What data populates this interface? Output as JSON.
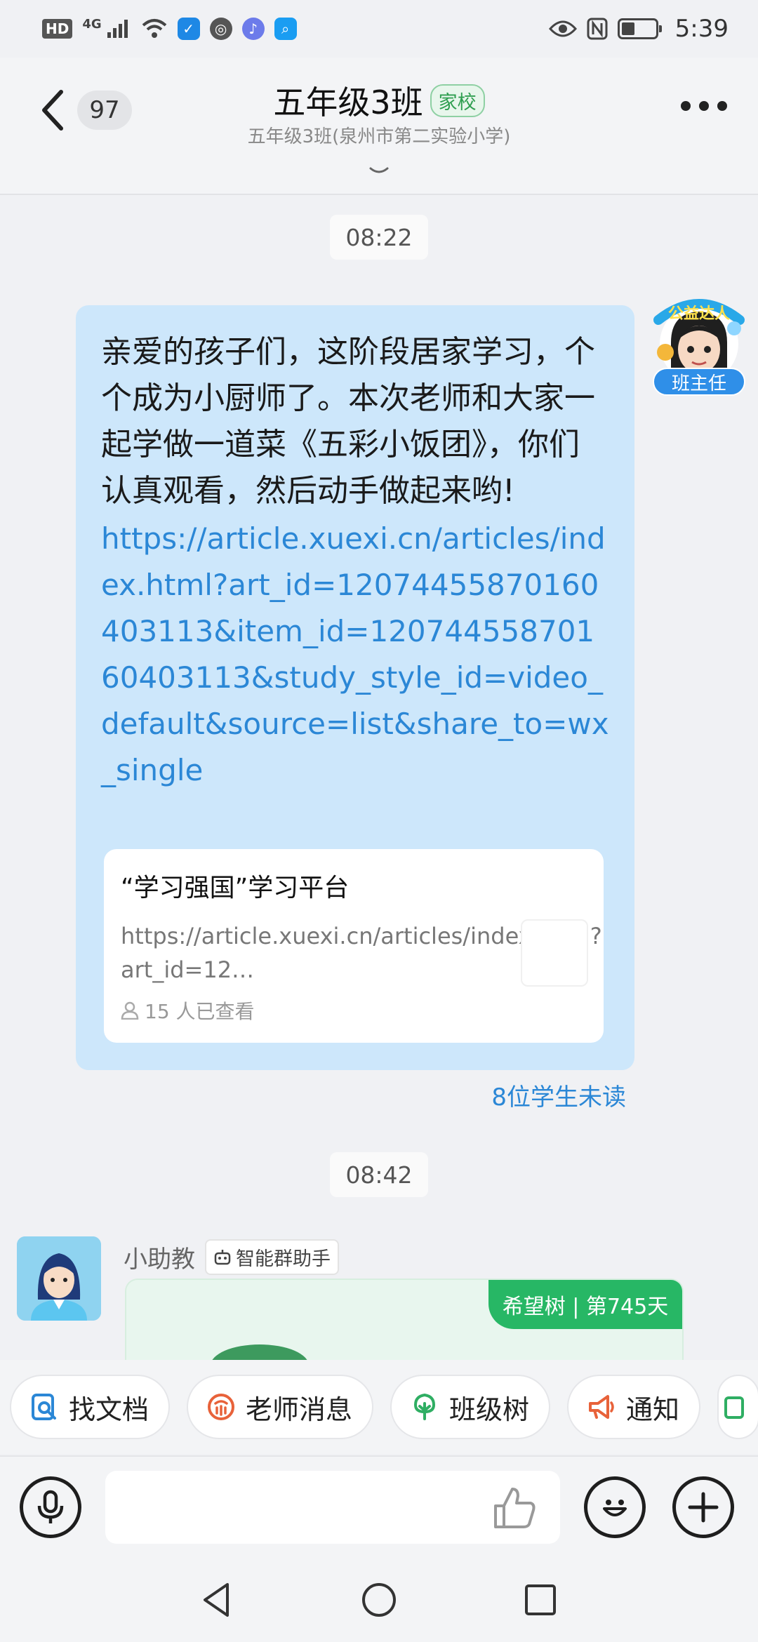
{
  "status_bar": {
    "hd": "HD",
    "network": "4G",
    "time": "5:39",
    "battery_percent": 40
  },
  "header": {
    "unread_count": "97",
    "title": "五年级3班",
    "tag": "家校",
    "subtitle": "五年级3班(泉州市第二实验小学)"
  },
  "messages": {
    "time1": "08:22",
    "teacher_text": "亲爱的孩子们，这阶段居家学习，个个成为小厨师了。本次老师和大家一起学做一道菜《五彩小饭团》，你们认真观看，然后动手做起来哟!",
    "teacher_link": "https://article.xuexi.cn/articles/index.html?art_id=12074455870160403113&item_id=12074455870160403113&study_style_id=video_default&source=list&share_to=wx_single",
    "link_card": {
      "title": "“学习强国”学习平台",
      "url": "https://article.xuexi.cn/articles/index.html?art_id=12…",
      "views": "15 人已查看"
    },
    "unread_students": "8位学生未读",
    "role_badge": "班主任",
    "avatar_frame_text": "公益达人",
    "time2": "08:42",
    "bot_name": "小助教",
    "bot_tag": "智能群助手",
    "bot_streak": "希望树 | 第745天"
  },
  "quick_actions": [
    {
      "label": "找文档",
      "icon": "doc-search-icon",
      "color": "#2b87d6"
    },
    {
      "label": "老师消息",
      "icon": "teacher-icon",
      "color": "#e8623a"
    },
    {
      "label": "班级树",
      "icon": "tree-icon",
      "color": "#2fae63"
    },
    {
      "label": "通知",
      "icon": "megaphone-icon",
      "color": "#e8623a"
    }
  ],
  "input": {
    "placeholder": ""
  },
  "colors": {
    "bubble": "#cde7fb",
    "link": "#2b87d6",
    "accent_green": "#27b765"
  }
}
